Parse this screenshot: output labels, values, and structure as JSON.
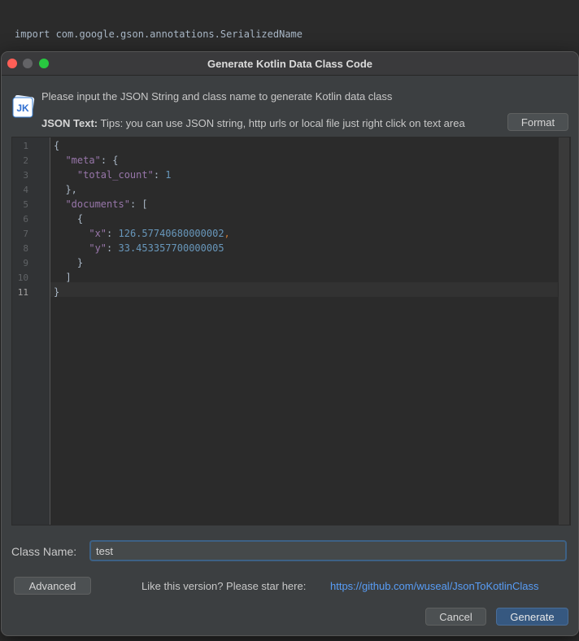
{
  "background": {
    "import_line": "import com.google.gson.annotations.SerializedName"
  },
  "dialog": {
    "title": "Generate Kotlin Data Class Code",
    "logo_text": "JK",
    "info": "Please input the JSON String and class name to generate Kotlin data class",
    "json_label": "JSON Text:",
    "json_tips": " Tips: you can use JSON string, http urls or local file just right click on text area",
    "format_button": "Format",
    "class_name_label": "Class Name:",
    "class_name_value": "test",
    "advanced_button": "Advanced",
    "star_text": "Like this version? Please star here:",
    "star_link": "https://github.com/wuseal/JsonToKotlinClass",
    "cancel_button": "Cancel",
    "generate_button": "Generate"
  },
  "editor": {
    "line_numbers": [
      "1",
      "2",
      "3",
      "4",
      "5",
      "6",
      "7",
      "8",
      "9",
      "10",
      "11"
    ],
    "current_line": "11",
    "lines": {
      "l1": "{",
      "l2_key": "\"meta\"",
      "l2_rest": ": {",
      "l3_key": "\"total_count\"",
      "l3_colon": ": ",
      "l3_val": "1",
      "l4": "},",
      "l5_key": "\"documents\"",
      "l5_rest": ": [",
      "l6": "{",
      "l7_key": "\"x\"",
      "l7_colon": ": ",
      "l7_val": "126.57740680000002",
      "l7_comma": ",",
      "l8_key": "\"y\"",
      "l8_colon": ": ",
      "l8_val": "33.453357700000005",
      "l9": "}",
      "l10": "]",
      "l11": "}"
    }
  },
  "colors": {
    "key": "#9876aa",
    "number": "#6897bb",
    "link": "#589df6",
    "primary_button": "#365880"
  }
}
